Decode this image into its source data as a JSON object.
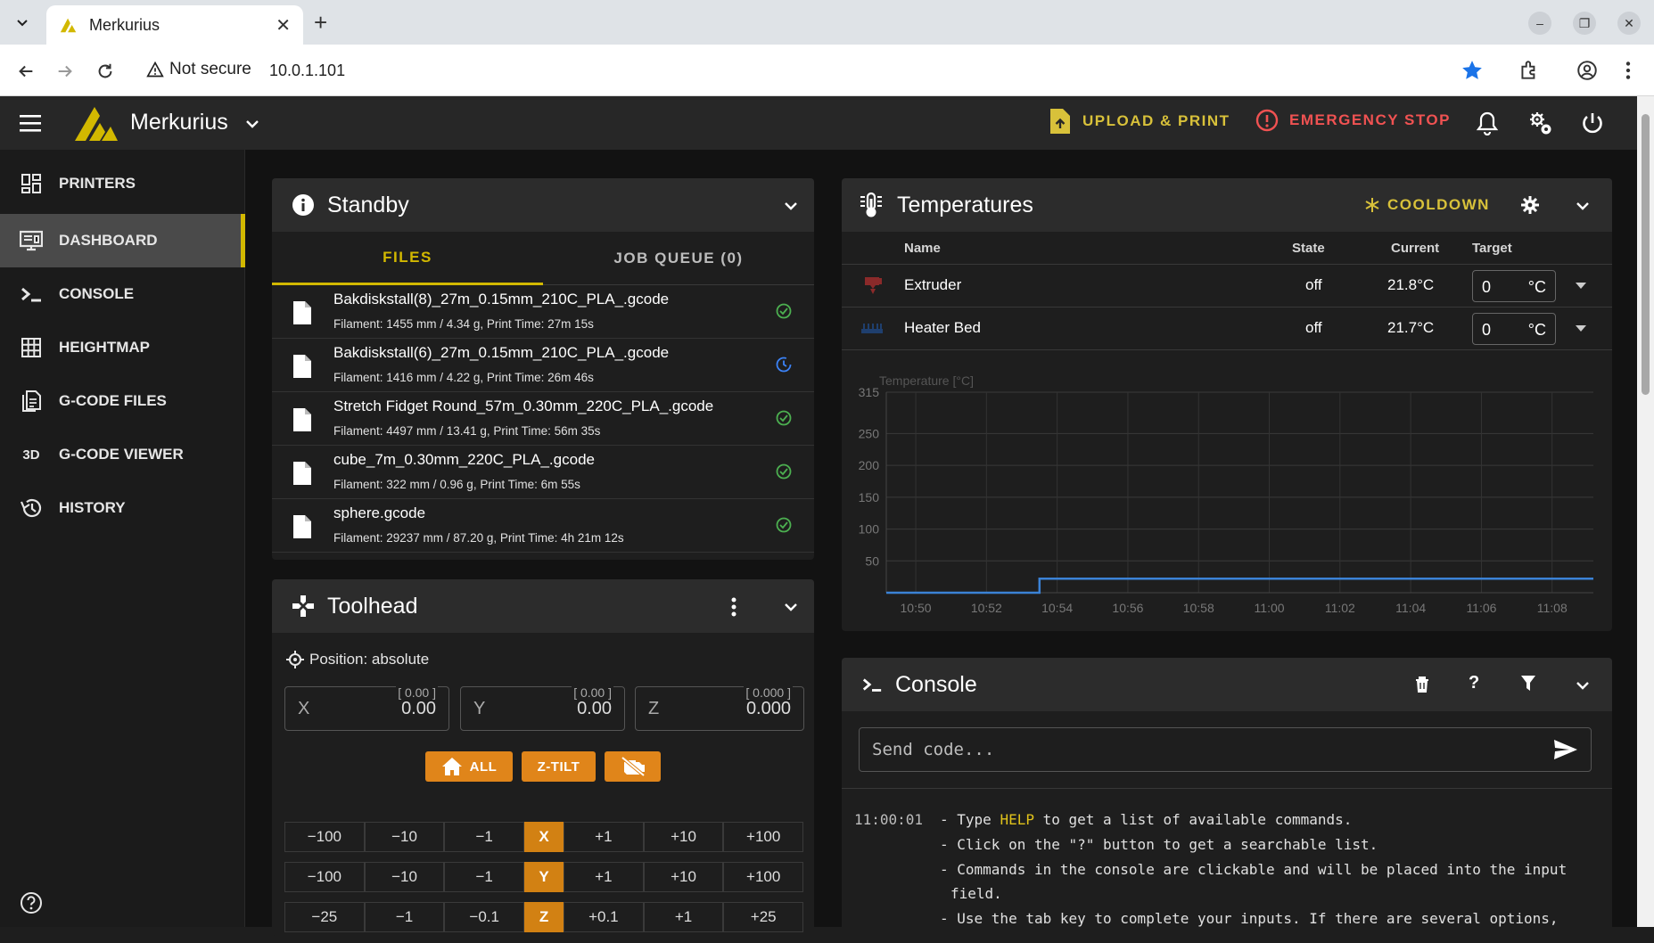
{
  "browser": {
    "tab_title": "Merkurius",
    "new_tab": "+",
    "security_label": "Not secure",
    "url": "10.0.1.101"
  },
  "appbar": {
    "printer_name": "Merkurius",
    "upload_label": "UPLOAD & PRINT",
    "estop_label": "EMERGENCY STOP"
  },
  "sidebar": {
    "items": [
      {
        "label": "PRINTERS",
        "icon": "printers-grid-icon"
      },
      {
        "label": "DASHBOARD",
        "icon": "dashboard-monitor-icon"
      },
      {
        "label": "CONSOLE",
        "icon": "console-icon"
      },
      {
        "label": "HEIGHTMAP",
        "icon": "heightmap-grid-icon"
      },
      {
        "label": "G-CODE FILES",
        "icon": "gcode-files-icon"
      },
      {
        "label": "G-CODE VIEWER",
        "icon": "3d-icon",
        "glyph": "3D"
      },
      {
        "label": "HISTORY",
        "icon": "history-icon"
      }
    ]
  },
  "standby": {
    "title": "Standby",
    "tab_files": "FILES",
    "tab_queue": "JOB QUEUE (0)",
    "files": [
      {
        "name": "Bakdiskstall(8)_27m_0.15mm_210C_PLA_.gcode",
        "meta": "Filament: 1455 mm / 4.34 g, Print Time: 27m 15s",
        "status": "completed"
      },
      {
        "name": "Bakdiskstall(6)_27m_0.15mm_210C_PLA_.gcode",
        "meta": "Filament: 1416 mm / 4.22 g, Print Time: 26m 46s",
        "status": "in-progress"
      },
      {
        "name": "Stretch Fidget Round_57m_0.30mm_220C_PLA_.gcode",
        "meta": "Filament: 4497 mm / 13.41 g, Print Time: 56m 35s",
        "status": "completed"
      },
      {
        "name": "cube_7m_0.30mm_220C_PLA_.gcode",
        "meta": "Filament: 322 mm / 0.96 g, Print Time: 6m 55s",
        "status": "completed"
      },
      {
        "name": "sphere.gcode",
        "meta": "Filament: 29237 mm / 87.20 g, Print Time: 4h 21m 12s",
        "status": "completed"
      }
    ]
  },
  "toolhead": {
    "title": "Toolhead",
    "position_label": "Position: absolute",
    "x": {
      "label": "X",
      "value": "0.00",
      "hint": "[ 0.00 ]"
    },
    "y": {
      "label": "Y",
      "value": "0.00",
      "hint": "[ 0.00 ]"
    },
    "z": {
      "label": "Z",
      "value": "0.000",
      "hint": "[ 0.000 ]"
    },
    "home_all": "ALL",
    "ztilt": "Z-TILT",
    "jog_rows": [
      {
        "axis": "X",
        "left": [
          "−100",
          "−10",
          "−1"
        ],
        "right": [
          "+1",
          "+10",
          "+100"
        ]
      },
      {
        "axis": "Y",
        "left": [
          "−100",
          "−10",
          "−1"
        ],
        "right": [
          "+1",
          "+10",
          "+100"
        ]
      },
      {
        "axis": "Z",
        "left": [
          "−25",
          "−1",
          "−0.1"
        ],
        "right": [
          "+0.1",
          "+1",
          "+25"
        ]
      }
    ]
  },
  "temps": {
    "title": "Temperatures",
    "cooldown": "COOLDOWN",
    "headers": {
      "name": "Name",
      "state": "State",
      "current": "Current",
      "target": "Target"
    },
    "rows": [
      {
        "name": "Extruder",
        "state": "off",
        "current": "21.8°C",
        "target": "0",
        "unit": "°C",
        "icon": "extruder-icon"
      },
      {
        "name": "Heater Bed",
        "state": "off",
        "current": "21.7°C",
        "target": "0",
        "unit": "°C",
        "icon": "heater-bed-icon"
      }
    ]
  },
  "chart_data": {
    "type": "line",
    "ylabel": "Temperature [°C]",
    "ylim": [
      0,
      315
    ],
    "yticks": [
      50,
      100,
      150,
      200,
      250,
      315
    ],
    "xticks": [
      "10:50",
      "10:52",
      "10:54",
      "10:56",
      "10:58",
      "11:00",
      "11:02",
      "11:04",
      "11:06",
      "11:08"
    ],
    "xlim": [
      "10:49:10",
      "11:09:10"
    ],
    "grid": true,
    "series": [
      {
        "color": "#3b82d6",
        "points": [
          [
            "10:49:10",
            0
          ],
          [
            "10:53:30",
            0
          ],
          [
            "10:53:30",
            22
          ],
          [
            "10:55:00",
            22
          ],
          [
            "11:09:10",
            22
          ]
        ]
      }
    ]
  },
  "console": {
    "title": "Console",
    "placeholder": "Send code...",
    "time": "11:00:01",
    "line1_pre": "- Type ",
    "line1_kw": "HELP",
    "line1_post": " to get a list of available commands.",
    "line2": "- Click on the \"?\" button to get a searchable list.",
    "line3": "- Commands in the console are clickable and will be placed into the input",
    "line4": "field.",
    "line5": "- Use the tab key to complete your inputs. If there are several options,"
  },
  "colors": {
    "accent": "#d2b800",
    "danger": "#f05252",
    "orange": "#e0851a",
    "series": "#3b82d6",
    "ok": "#4caf50",
    "progress": "#3b82f6"
  }
}
